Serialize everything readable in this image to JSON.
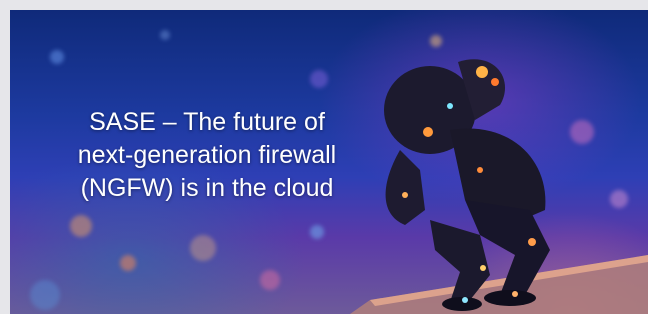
{
  "banner": {
    "headline_lines": [
      "SASE – The future of",
      "next-generation firewall",
      "(NGFW) is in the cloud"
    ],
    "image_subject": "robot-crouching-on-ledge",
    "colors": {
      "text": "#ffffff",
      "sky_top": "#0f2a7a",
      "sky_mid": "#2e3fb5",
      "haze_purple": "#6d5a9a",
      "glow_orange": "#ff9a3c",
      "ledge": "#c7897c"
    }
  }
}
